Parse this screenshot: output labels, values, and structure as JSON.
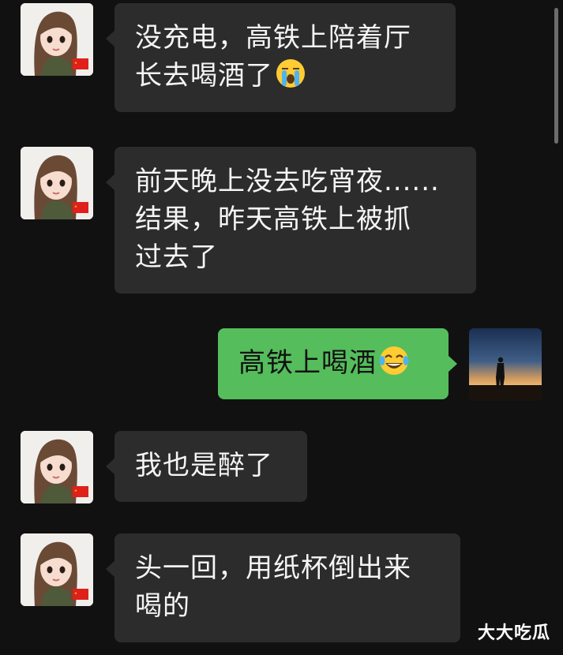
{
  "conversation": {
    "messages": [
      {
        "side": "left",
        "lines": [
          "没充电，高铁上陪着厅",
          "长去喝酒了"
        ],
        "emoji": "crying-face-icon"
      },
      {
        "side": "left",
        "lines": [
          "前天晚上没去吃宵夜......",
          "结果，昨天高铁上被抓",
          "过去了"
        ]
      },
      {
        "side": "right",
        "lines": [
          "高铁上喝酒"
        ],
        "emoji": "tears-of-joy-icon"
      },
      {
        "side": "left",
        "lines": [
          "我也是醉了"
        ]
      },
      {
        "side": "left",
        "lines": [
          "头一回，用纸杯倒出来",
          "喝的"
        ]
      }
    ]
  },
  "watermark": {
    "text": "大大吃瓜"
  },
  "colors": {
    "background": "#111111",
    "incoming_bubble": "#2c2c2c",
    "outgoing_bubble": "#55bd5c"
  }
}
